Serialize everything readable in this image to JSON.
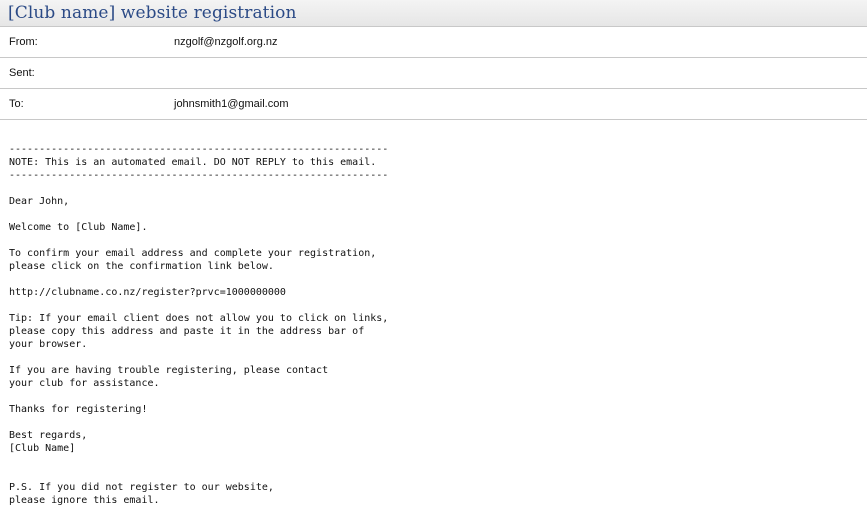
{
  "email": {
    "title": "[Club name] website registration",
    "headers": {
      "from_label": "From:",
      "from_value": "nzgolf@nzgolf.org.nz",
      "sent_label": "Sent:",
      "sent_value": "",
      "to_label": "To:",
      "to_value": "johnsmith1@gmail.com"
    },
    "body": "---------------------------------------------------------------\nNOTE: This is an automated email. DO NOT REPLY to this email.\n---------------------------------------------------------------\n\nDear John,\n\nWelcome to [Club Name].\n\nTo confirm your email address and complete your registration,\nplease click on the confirmation link below.\n\nhttp://clubname.co.nz/register?prvc=1000000000\n\nTip: If your email client does not allow you to click on links,\nplease copy this address and paste it in the address bar of\nyour browser.\n\nIf you are having trouble registering, please contact\nyour club for assistance.\n\nThanks for registering!\n\nBest regards,\n[Club Name]\n\n\nP.S. If you did not register to our website,\nplease ignore this email."
  }
}
